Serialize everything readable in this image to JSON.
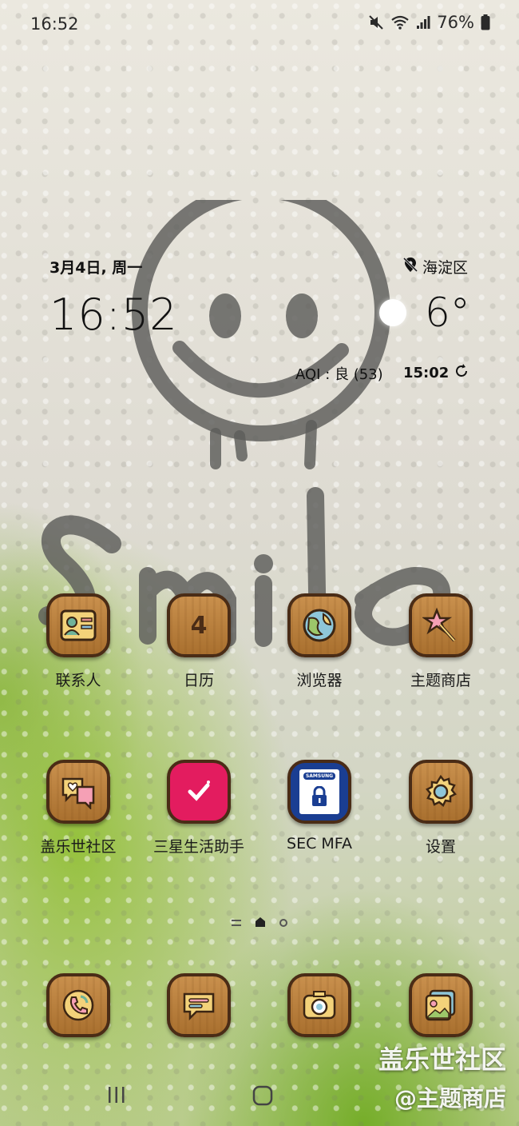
{
  "status_bar": {
    "time": "16:52",
    "battery": "76%",
    "icons": [
      "mute-icon",
      "wifi-icon",
      "signal-icon",
      "battery-icon"
    ]
  },
  "widget": {
    "date": "3月4日, 周一",
    "location": "海淀区",
    "clock": "16:52",
    "temperature": "6°",
    "aqi": "AQI : 良 (53)",
    "updated": "15:02"
  },
  "apps": [
    {
      "label": "联系人",
      "icon": "contacts-icon"
    },
    {
      "label": "日历",
      "icon": "calendar-icon",
      "badge": "4"
    },
    {
      "label": "浏览器",
      "icon": "browser-icon"
    },
    {
      "label": "主题商店",
      "icon": "theme-store-icon"
    },
    {
      "label": "盖乐世社区",
      "icon": "community-icon"
    },
    {
      "label": "三星生活助手",
      "icon": "life-assistant-icon"
    },
    {
      "label": "SEC MFA",
      "icon": "sec-mfa-icon",
      "icon_text": "SAMSUNG"
    },
    {
      "label": "设置",
      "icon": "settings-icon"
    }
  ],
  "dock": [
    {
      "icon": "phone-icon"
    },
    {
      "icon": "messages-icon"
    },
    {
      "icon": "camera-icon"
    },
    {
      "icon": "gallery-icon"
    }
  ],
  "watermark": {
    "line1": "盖乐世社区",
    "line2": "@主题商店"
  },
  "colors": {
    "wood": "#b57c3a",
    "wood_border": "#4a2c16",
    "text": "#111111"
  }
}
